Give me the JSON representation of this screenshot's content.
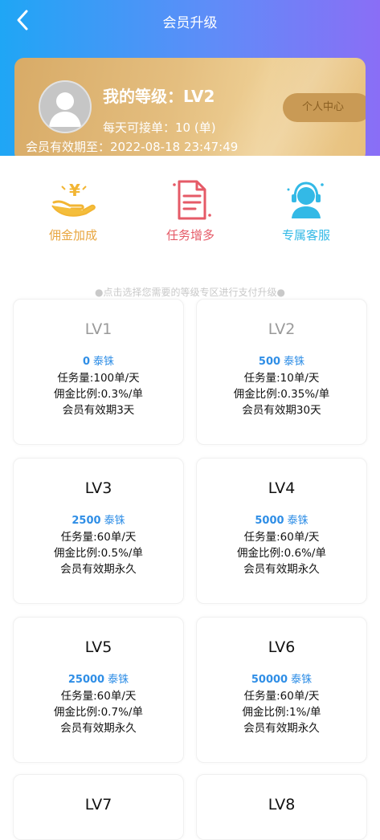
{
  "header": {
    "title": "会员升级"
  },
  "card": {
    "level_text": "我的等级：LV2",
    "daily_text": "每天可接单：10 (单)",
    "valid_text": "会员有效期至：2022-08-18 23:47:49",
    "personal_center": "个人中心"
  },
  "features": [
    {
      "label": "佣金加成",
      "icon": "hand-money-icon"
    },
    {
      "label": "任务增多",
      "icon": "document-icon"
    },
    {
      "label": "专属客服",
      "icon": "support-agent-icon"
    }
  ],
  "hint": "●点击选择您需要的等级专区进行支付升级●",
  "currency": "泰铢",
  "levels": [
    {
      "name": "LV1",
      "price": "0",
      "tasks": "任务量:100单/天",
      "commission": "佣金比例:0.3%/单",
      "validity": "会员有效期3天"
    },
    {
      "name": "LV2",
      "price": "500",
      "tasks": "任务量:10单/天",
      "commission": "佣金比例:0.35%/单",
      "validity": "会员有效期30天"
    },
    {
      "name": "LV3",
      "price": "2500",
      "tasks": "任务量:60单/天",
      "commission": "佣金比例:0.5%/单",
      "validity": "会员有效期永久"
    },
    {
      "name": "LV4",
      "price": "5000",
      "tasks": "任务量:60单/天",
      "commission": "佣金比例:0.6%/单",
      "validity": "会员有效期永久"
    },
    {
      "name": "LV5",
      "price": "25000",
      "tasks": "任务量:60单/天",
      "commission": "佣金比例:0.7%/单",
      "validity": "会员有效期永久"
    },
    {
      "name": "LV6",
      "price": "50000",
      "tasks": "任务量:60单/天",
      "commission": "佣金比例:1%/单",
      "validity": "会员有效期永久"
    },
    {
      "name": "LV7"
    },
    {
      "name": "LV8"
    }
  ],
  "colors": {
    "header_gradient_start": "#1fa6f5",
    "header_gradient_end": "#8a6ef6",
    "card_gold": "#e4be7f",
    "price_blue": "#2f8ee6",
    "feature_gold": "#e8a640",
    "feature_red": "#e55a67",
    "feature_cyan": "#33b9e6"
  }
}
